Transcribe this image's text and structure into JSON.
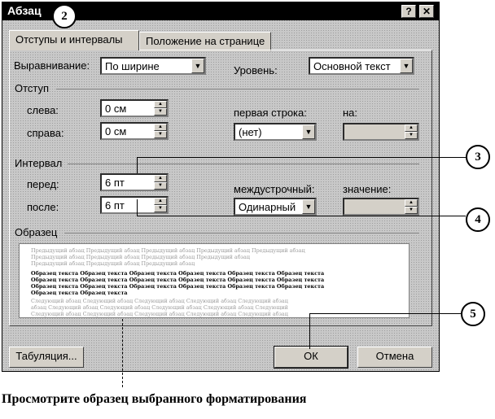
{
  "dialog": {
    "title": "Абзац",
    "help_button": "?",
    "close_button": "✕"
  },
  "tabs": [
    {
      "label": "Отступы и интервалы"
    },
    {
      "label": "Положение на странице"
    }
  ],
  "alignment": {
    "label": "Выравнивание:",
    "value": "По ширине"
  },
  "level": {
    "label": "Уровень:",
    "value": "Основной текст"
  },
  "indent": {
    "group": "Отступ",
    "left_label": "слева:",
    "left_value": "0 см",
    "right_label": "справа:",
    "right_value": "0 см",
    "first_line_label": "первая строка:",
    "first_line_value": "(нет)",
    "by_label": "на:",
    "by_value": ""
  },
  "spacing": {
    "group": "Интервал",
    "before_label": "перед:",
    "before_value": "6 пт",
    "after_label": "после:",
    "after_value": "6 пт",
    "line_label": "междустрочный:",
    "line_value": "Одинарный",
    "at_label": "значение:",
    "at_value": ""
  },
  "preview": {
    "group": "Образец",
    "prev_lines": [
      "Предыдущий абзац Предыдущий абзац Предыдущий абзац Предыдущий абзац Предыдущий абзац",
      "Предыдущий абзац Предыдущий абзац Предыдущий абзац Предыдущий абзац",
      "Предыдущий абзац Предыдущий абзац Предыдущий абзац"
    ],
    "sample_lines": [
      "Образец текста Образец текста Образец текста Образец текста Образец текста Образец текста",
      "Образец текста Образец текста Образец текста Образец текста Образец текста Образец текста",
      "Образец текста Образец текста Образец текста Образец текста Образец текста Образец текста",
      "Образец текста Образец текста"
    ],
    "next_lines": [
      "Следующий абзац Следующий абзац Следующий абзац Следующий абзац Следующий абзац",
      "абзац Следующий абзац Следующий абзац Следующий абзац Следующий абзац Следующий",
      "Следующий абзац Следующий абзац Следующий абзац Следующий абзац Следующий абзац"
    ]
  },
  "buttons": {
    "tabs": "Табуляция...",
    "ok": "ОК",
    "cancel": "Отмена"
  },
  "callouts": [
    "2",
    "3",
    "4",
    "5"
  ],
  "caption": "Просмотрите образец выбранного форматирования"
}
